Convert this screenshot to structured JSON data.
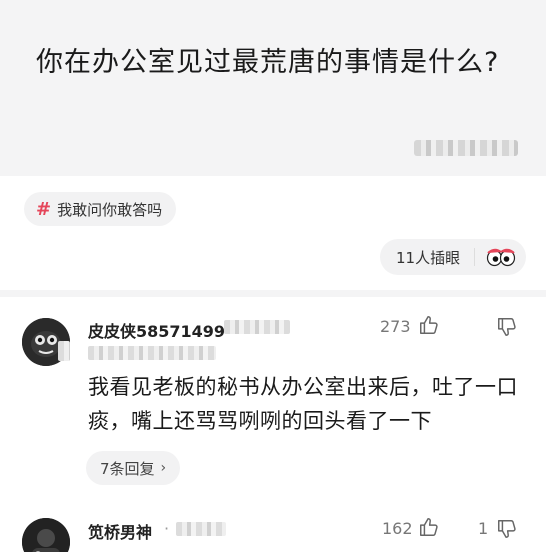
{
  "question": {
    "title": "你在办公室见过最荒唐的事情是什么?"
  },
  "topic": {
    "hash_symbol": "#",
    "label": "我敢问你敢答吗"
  },
  "reaction": {
    "count_label": "11人插眼",
    "icon": "eyes-icon"
  },
  "comments": [
    {
      "username": "皮皮侠58571499",
      "likes": "273",
      "dislikes": "",
      "text": "我看见老板的秘书从办公室出来后，吐了一口痰，嘴上还骂骂咧咧的回头看了一下",
      "replies_label": "7条回复"
    },
    {
      "username": "笕桥男神",
      "separator": "·",
      "likes": "162",
      "dislikes": "1"
    }
  ],
  "colors": {
    "accent": "#e5465a",
    "card_bg": "#f4f4f5"
  }
}
